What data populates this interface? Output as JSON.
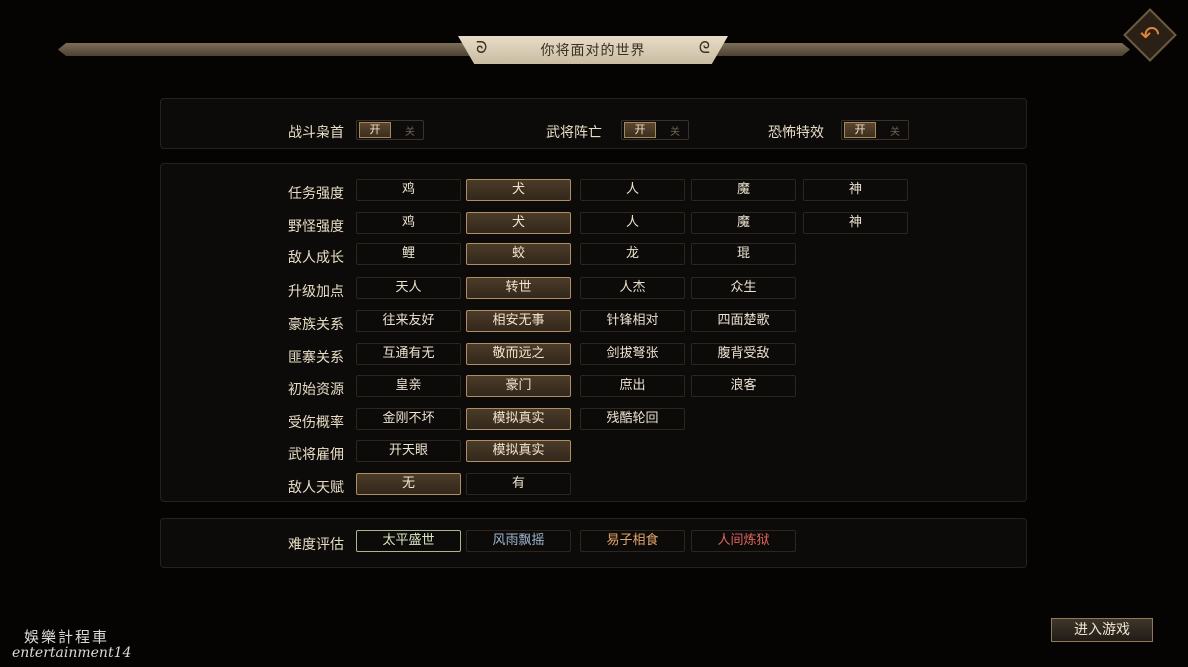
{
  "header": {
    "title": "你将面对的世界"
  },
  "toggles": [
    {
      "label": "战斗枭首",
      "on": "开",
      "off": "关"
    },
    {
      "label": "武将阵亡",
      "on": "开",
      "off": "关"
    },
    {
      "label": "恐怖特效",
      "on": "开",
      "off": "关"
    }
  ],
  "settings": [
    {
      "label": "任务强度",
      "options": [
        "鸡",
        "犬",
        "人",
        "魔",
        "神"
      ],
      "selected": 1
    },
    {
      "label": "野怪强度",
      "options": [
        "鸡",
        "犬",
        "人",
        "魔",
        "神"
      ],
      "selected": 1
    },
    {
      "label": "敌人成长",
      "options": [
        "鲤",
        "蛟",
        "龙",
        "琨"
      ],
      "selected": 1
    },
    {
      "label": "升级加点",
      "options": [
        "天人",
        "转世",
        "人杰",
        "众生"
      ],
      "selected": 1
    },
    {
      "label": "豪族关系",
      "options": [
        "往来友好",
        "相安无事",
        "针锋相对",
        "四面楚歌"
      ],
      "selected": 1
    },
    {
      "label": "匪寨关系",
      "options": [
        "互通有无",
        "敬而远之",
        "剑拔弩张",
        "腹背受敌"
      ],
      "selected": 1
    },
    {
      "label": "初始资源",
      "options": [
        "皇亲",
        "豪门",
        "庶出",
        "浪客"
      ],
      "selected": 1
    },
    {
      "label": "受伤概率",
      "options": [
        "金刚不坏",
        "模拟真实",
        "残酷轮回"
      ],
      "selected": 1
    },
    {
      "label": "武将雇佣",
      "options": [
        "开天眼",
        "模拟真实"
      ],
      "selected": 1
    },
    {
      "label": "敌人天赋",
      "options": [
        "无",
        "有"
      ],
      "selected": 0
    }
  ],
  "difficulty": {
    "label": "难度评估",
    "options": [
      "太平盛世",
      "风雨飘摇",
      "易子相食",
      "人间炼狱"
    ],
    "colors": [
      "#d8e7c2",
      "#9fb7cf",
      "#e4a56b",
      "#e0655a"
    ],
    "selected": 0
  },
  "footer": {
    "enter_label": "进入游戏"
  },
  "watermark": {
    "line1": "娛樂計程車",
    "line2": "entertainment14"
  },
  "colors": {
    "accent": "#b08e5f",
    "back_icon": "#e0863a"
  }
}
